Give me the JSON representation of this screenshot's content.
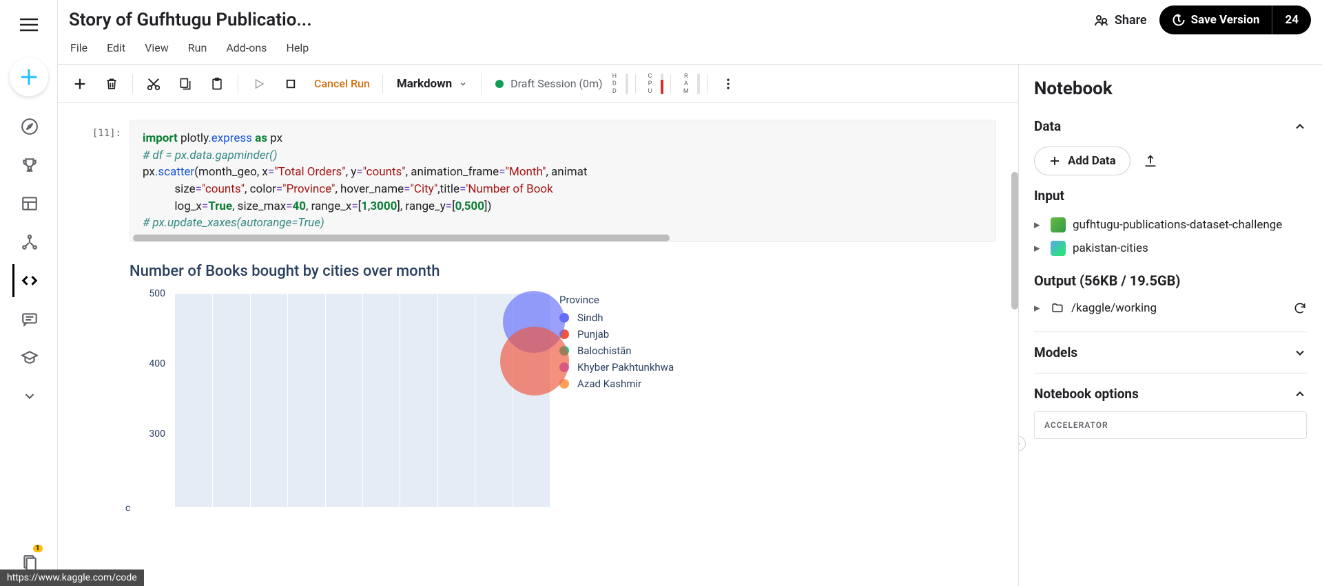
{
  "header": {
    "title": "Story of Gufhtugu Publicatio...",
    "share_label": "Share",
    "save_label": "Save Version",
    "save_count": "24",
    "menus": {
      "file": "File",
      "edit": "Edit",
      "view": "View",
      "run": "Run",
      "addons": "Add-ons",
      "help": "Help"
    }
  },
  "toolbar": {
    "cancel_run": "Cancel Run",
    "cell_type": "Markdown",
    "session_status": "Draft Session (0m)",
    "meters": {
      "hdd": "H\nD\nD",
      "cpu": "C\nP\nU",
      "ram": "R\nA\nM"
    }
  },
  "cell": {
    "prompt": "[11]:",
    "code": {
      "l1a": "import",
      "l1b": " plotly",
      "l1c": ".express ",
      "l1d": "as",
      "l1e": " px",
      "l2": "# df = px.data.gapminder()",
      "l3a": "px",
      "l3b": ".scatter",
      "l3c": "(month_geo, x",
      "l3d": "=",
      "l3e": "\"Total Orders\"",
      "l3f": ", y",
      "l3g": "=",
      "l3h": "\"counts\"",
      "l3i": ", animation_frame",
      "l3j": "=",
      "l3k": "\"Month\"",
      "l3l": ", animat",
      "l4a": "           size",
      "l4b": "=",
      "l4c": "\"counts\"",
      "l4d": ", color",
      "l4e": "=",
      "l4f": "\"Province\"",
      "l4g": ", hover_name",
      "l4h": "=",
      "l4i": "\"City\"",
      "l4j": ",title",
      "l4k": "=",
      "l4l": "'Number of Book",
      "l5a": "           log_x",
      "l5b": "=",
      "l5c": "True",
      "l5d": ", size_max",
      "l5e": "=",
      "l5f": "40",
      "l5g": ", range_x",
      "l5h": "=",
      "l5i": "[",
      "l5j": "1",
      "l5k": ",",
      "l5l": "3000",
      "l5m": "], range_y",
      "l5n": "=",
      "l5o": "[",
      "l5p": "0",
      "l5q": ",",
      "l5r": "500",
      "l5s": "])",
      "l6": "# px.update_xaxes(autorange=True)"
    }
  },
  "chart_data": {
    "type": "scatter",
    "title": "Number of Books bought by cities over month",
    "ylabel": "c",
    "y_ticks": {
      "t500": "500",
      "t400": "400",
      "t300": "300"
    },
    "ylim": [
      0,
      500
    ],
    "xlim": [
      1,
      3000
    ],
    "legend_title": "Province",
    "series": [
      {
        "name": "Sindh",
        "color": "#636efa"
      },
      {
        "name": "Punjab",
        "color": "#ef553b"
      },
      {
        "name": "Balochistān",
        "color": "#00cc96"
      },
      {
        "name": "Khyber Pakhtunkhwa",
        "color": "#ab63fa"
      },
      {
        "name": "Azad Kashmir",
        "color": "#ffa15a"
      }
    ],
    "visible_points": [
      {
        "province": "Sindh",
        "x_approx": 2800,
        "y_approx": 460,
        "size": 90
      },
      {
        "province": "Punjab",
        "x_approx": 2900,
        "y_approx": 400,
        "size": 100
      }
    ]
  },
  "right": {
    "panel_title": "Notebook",
    "data_title": "Data",
    "add_data": "Add Data",
    "input_title": "Input",
    "datasets": {
      "d1": "gufhtugu-publications-dataset-challenge",
      "d2": "pakistan-cities"
    },
    "output_title": "Output (56KB / 19.5GB)",
    "output_path": "/kaggle/working",
    "models_title": "Models",
    "options_title": "Notebook options",
    "accelerator_label": "ACCELERATOR"
  },
  "status_url": "https://www.kaggle.com/code"
}
